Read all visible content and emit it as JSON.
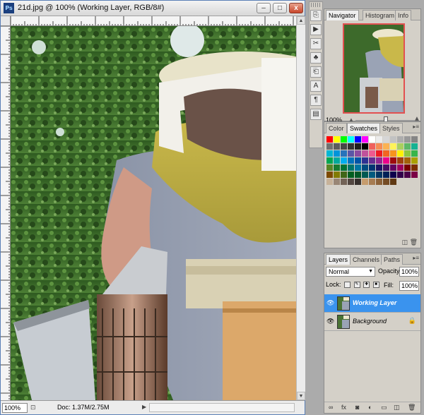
{
  "document": {
    "title": "21d.jpg @ 100% (Working Layer, RGB/8#)",
    "app_icon": "Ps",
    "zoom": "100%",
    "doc_size": "Doc: 1.37M/2.75M"
  },
  "window_controls": {
    "minimize": "–",
    "maximize": "□",
    "close": "x"
  },
  "tools": [
    {
      "icon": "history-brush-icon",
      "glyph": "⎘"
    },
    {
      "icon": "actions-icon",
      "glyph": "▶"
    },
    {
      "icon": "tool-presets-icon",
      "glyph": "✂"
    },
    {
      "icon": "brushes-icon",
      "glyph": "♣"
    },
    {
      "icon": "clone-source-icon",
      "glyph": "⎗"
    },
    {
      "icon": "character-icon",
      "glyph": "A"
    },
    {
      "icon": "paragraph-icon",
      "glyph": "¶"
    },
    {
      "icon": "layer-comps-icon",
      "glyph": "▤"
    }
  ],
  "navigator": {
    "tabs": [
      "Navigator",
      "Histogram",
      "Info"
    ],
    "zoom": "100%"
  },
  "swatches": {
    "tabs": [
      "Color",
      "Swatches",
      "Styles"
    ],
    "colors": [
      "#ff0000",
      "#ffff00",
      "#00ff00",
      "#00ffff",
      "#0000ff",
      "#ff00ff",
      "#ffffff",
      "#ebebeb",
      "#d6d6d6",
      "#c2c2c2",
      "#adadad",
      "#999999",
      "#858585",
      "#707070",
      "#5c5c5c",
      "#474747",
      "#333333",
      "#1f1f1f",
      "#000000",
      "#f0605c",
      "#f58c54",
      "#fbb253",
      "#fff359",
      "#a9d05e",
      "#5cb867",
      "#16b292",
      "#00b6d4",
      "#0094d9",
      "#2773bb",
      "#5a56a6",
      "#8b4ba0",
      "#c0529b",
      "#ee5a8f",
      "#ed1c24",
      "#f26522",
      "#f7941d",
      "#fff200",
      "#8dc63f",
      "#39b54a",
      "#00a651",
      "#00a99d",
      "#00aeef",
      "#0072bc",
      "#0054a6",
      "#2e3192",
      "#662d91",
      "#92278f",
      "#ec008c",
      "#9e0b0f",
      "#a0410d",
      "#a36209",
      "#aba000",
      "#598527",
      "#197b30",
      "#007236",
      "#00746b",
      "#0076a3",
      "#004b80",
      "#003471",
      "#1b1464",
      "#440e62",
      "#630460",
      "#9e005d",
      "#790000",
      "#7b2e00",
      "#7d4900",
      "#827b00",
      "#406618",
      "#005e20",
      "#005826",
      "#005952",
      "#005b7f",
      "#003663",
      "#002157",
      "#0d004c",
      "#32004b",
      "#4b0049",
      "#7b0046",
      "#c7b299",
      "#998675",
      "#736357",
      "#534741",
      "#37302d",
      "#c69c6d",
      "#a67c52",
      "#8c6239",
      "#754c24",
      "#603913"
    ]
  },
  "layers": {
    "tabs": [
      "Layers",
      "Channels",
      "Paths"
    ],
    "blend_mode": "Normal",
    "opacity_label": "Opacity:",
    "opacity": "100%",
    "lock_label": "Lock:",
    "fill_label": "Fill:",
    "fill": "100%",
    "items": [
      {
        "name": "Working Layer",
        "selected": true
      },
      {
        "name": "Background",
        "locked": true
      }
    ]
  }
}
